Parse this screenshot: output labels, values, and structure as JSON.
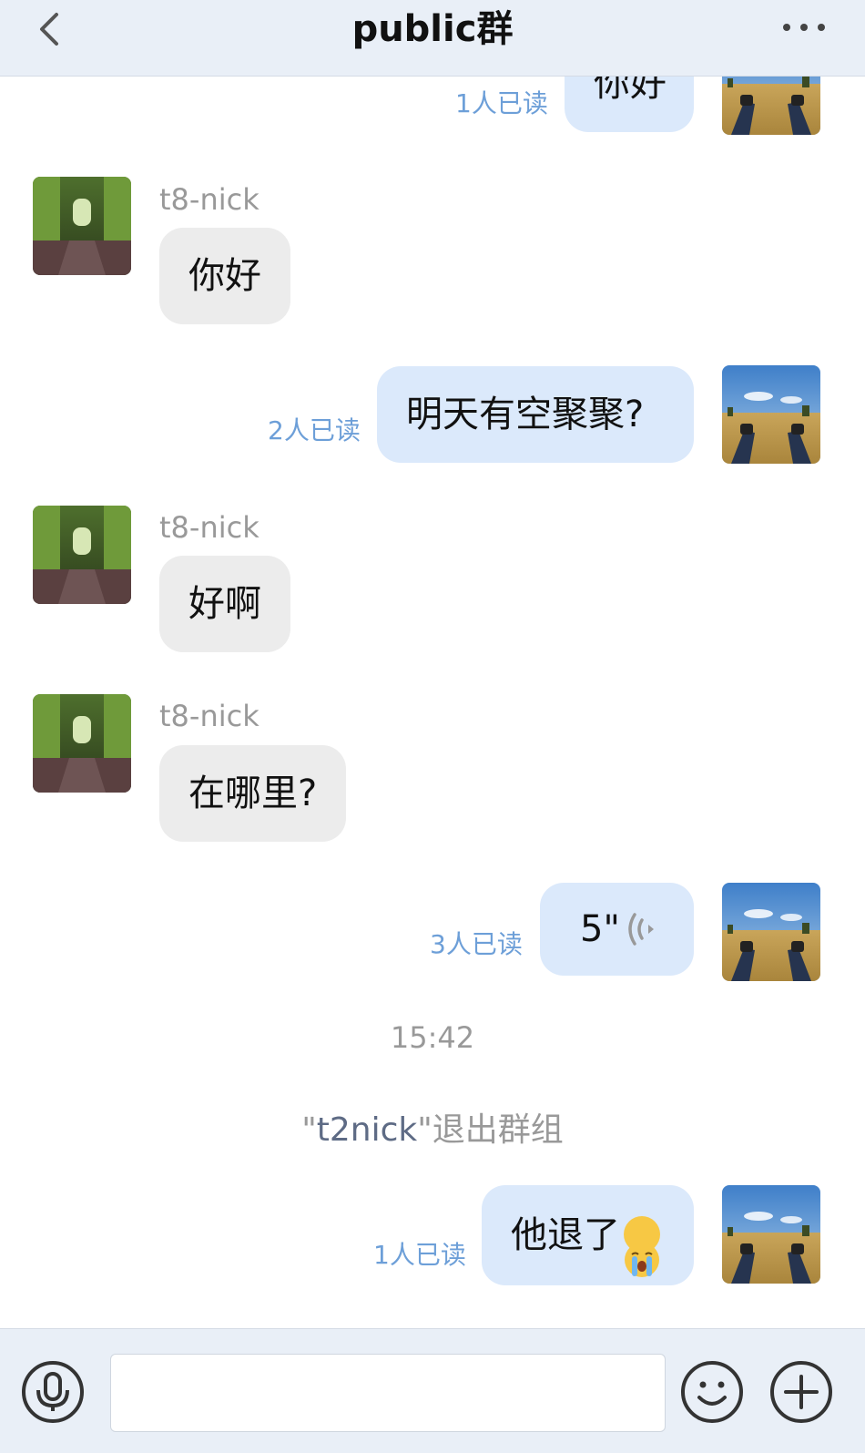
{
  "header": {
    "title": "public群"
  },
  "messages": [
    {
      "dir": "out",
      "text": "你好",
      "read": "1人已读"
    },
    {
      "dir": "in",
      "nick": "t8-nick",
      "text": "你好"
    },
    {
      "dir": "out",
      "text": "明天有空聚聚?",
      "read": "2人已读"
    },
    {
      "dir": "in",
      "nick": "t8-nick",
      "text": "好啊"
    },
    {
      "dir": "in",
      "nick": "t8-nick",
      "text": "在哪里?"
    },
    {
      "dir": "out",
      "type": "voice",
      "duration": "5\"",
      "read": "3人已读"
    },
    {
      "dir": "out",
      "text": "他退了",
      "emoji": "crying-face-emoji",
      "read": "1人已读"
    }
  ],
  "timestamp": "15:42",
  "system": {
    "quote_open": "\"",
    "user": "t2nick",
    "quote_close": "\"",
    "action": "退出群组"
  },
  "input": {
    "value": ""
  },
  "icons": {
    "back": "chevron-left-icon",
    "more": "more-dots-icon",
    "voice": "microphone-icon",
    "emoji": "smiley-icon",
    "plus": "plus-icon"
  },
  "colors": {
    "header_bg": "#e9eff7",
    "outgoing_bubble": "#dbe9fb",
    "incoming_bubble": "#ececec",
    "read_receipt": "#6d9fd8"
  }
}
